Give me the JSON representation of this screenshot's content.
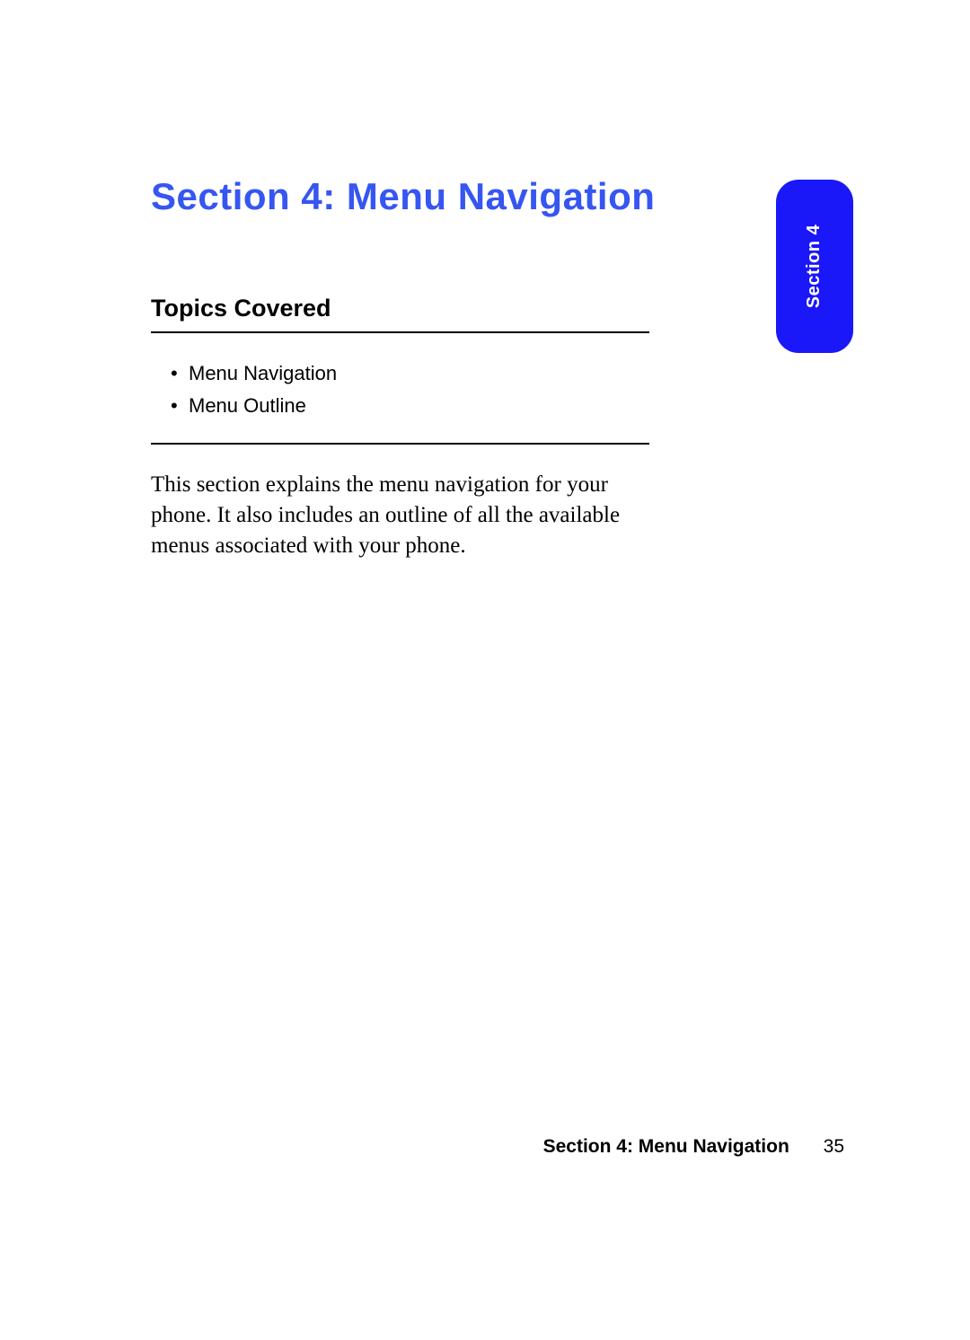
{
  "title": "Section 4: Menu Navigation",
  "tab": {
    "label": "Section 4"
  },
  "topics": {
    "heading": "Topics Covered",
    "items": [
      "Menu Navigation",
      "Menu Outline"
    ]
  },
  "body": "This section explains the menu navigation for your phone. It also includes an outline of all the available menus associated with your phone.",
  "footer": {
    "title": "Section 4: Menu Navigation",
    "page": "35"
  }
}
